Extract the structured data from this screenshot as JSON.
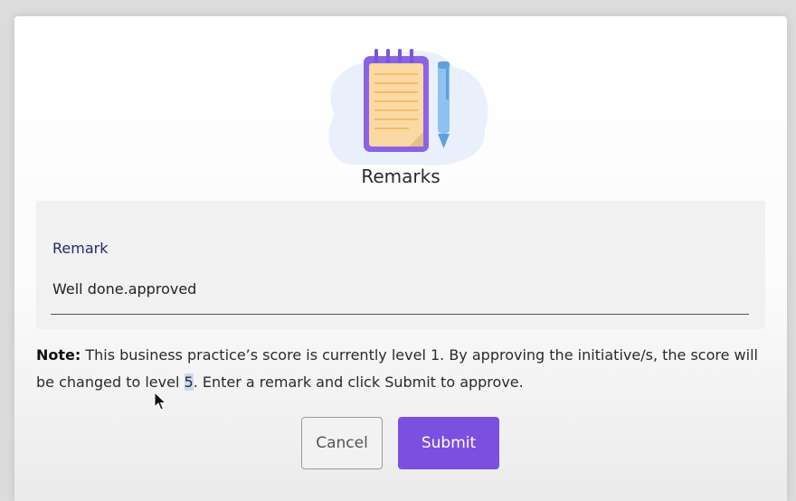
{
  "dialog": {
    "title": "Remarks",
    "illustration": "notepad-with-pen-icon",
    "remark_field": {
      "label": "Remark",
      "value": "Well done.approved"
    },
    "note": {
      "prefix": "Note:",
      "text_before": " This business practice’s score is currently level 1. By approving the initiative/s, the score will be changed to level ",
      "highlighted_level": "5",
      "text_after": ". Enter a remark and click Submit to approve."
    },
    "buttons": {
      "cancel_label": "Cancel",
      "submit_label": "Submit"
    }
  },
  "colors": {
    "accent": "#7b4fe0",
    "label": "#1f2a6b",
    "field_bg": "#f1f1f1"
  }
}
